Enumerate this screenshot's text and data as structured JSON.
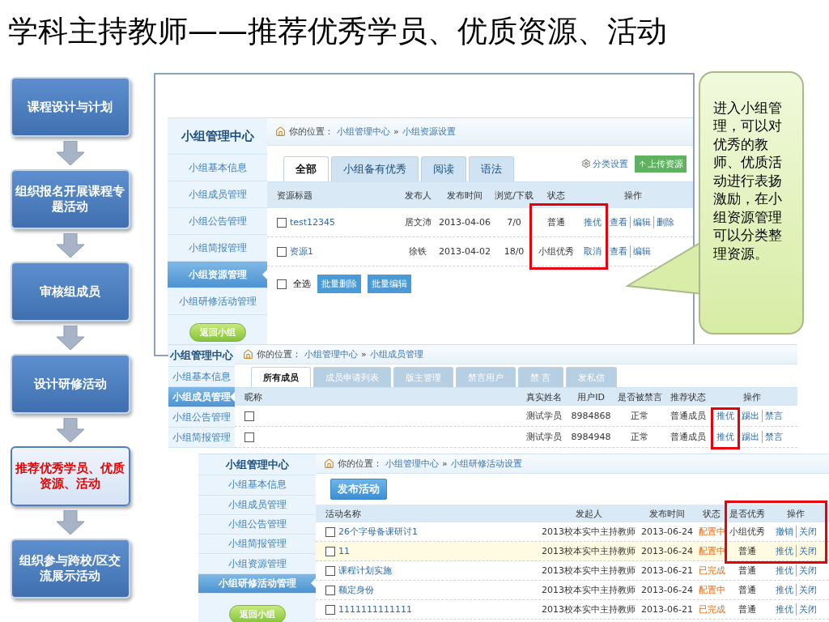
{
  "title": "学科主持教师——推荐优秀学员、优质资源、活动",
  "flow_steps": [
    {
      "label": "课程设计与计划",
      "highlighted": false
    },
    {
      "label": "组织报名开展课程专题活动",
      "highlighted": false
    },
    {
      "label": "审核组成员",
      "highlighted": false
    },
    {
      "label": "设计研修活动",
      "highlighted": false
    },
    {
      "label": "推荐优秀学员、优质资源、活动",
      "highlighted": true
    },
    {
      "label": "组织参与跨校/区交流展示活动",
      "highlighted": false
    }
  ],
  "resource_panel": {
    "sidebar": {
      "title": "小组管理中心",
      "items": [
        {
          "label": "小组基本信息",
          "selected": false
        },
        {
          "label": "小组成员管理",
          "selected": false
        },
        {
          "label": "小组公告管理",
          "selected": false
        },
        {
          "label": "小组简报管理",
          "selected": false
        },
        {
          "label": "小组资源管理",
          "selected": true
        },
        {
          "label": "小组研修活动管理",
          "selected": false
        }
      ],
      "back_button": "返回小组"
    },
    "breadcrumb": {
      "prefix": "你的位置：",
      "path": [
        "小组管理中心",
        "小组资源设置"
      ],
      "separator": "»"
    },
    "tabs": [
      {
        "label": "全部",
        "selected": true
      },
      {
        "label": "小组备有优秀",
        "selected": false
      },
      {
        "label": "阅读",
        "selected": false
      },
      {
        "label": "语法",
        "selected": false
      }
    ],
    "tools": [
      {
        "kind": "link",
        "label": "分类设置"
      },
      {
        "kind": "button",
        "label": "上传资源"
      }
    ],
    "columns": [
      {
        "label": "资源标题",
        "kind": "title"
      },
      {
        "label": "发布人",
        "kind": "text"
      },
      {
        "label": "发布时间",
        "kind": "text"
      },
      {
        "label": "浏览/下载",
        "kind": "text"
      },
      {
        "label": "状态",
        "kind": "text"
      },
      {
        "label": "操作",
        "kind": "actions"
      }
    ],
    "rows": [
      {
        "checked": false,
        "hovered": false,
        "cells": [
          "test12345",
          "居文沛",
          "2013-04-06",
          "7/0",
          "普通"
        ],
        "actions": [
          [
            "推优"
          ],
          [
            "查看",
            "编辑",
            "删除"
          ]
        ]
      },
      {
        "checked": false,
        "hovered": false,
        "cells": [
          "资源1",
          "徐铁",
          "2013-04-02",
          "18/0",
          "小组优秀"
        ],
        "actions": [
          [
            "取消"
          ],
          [
            "查看",
            "编辑"
          ]
        ]
      }
    ],
    "footer": {
      "select_all": {
        "label": "全选",
        "checked": false
      },
      "buttons": [
        "批量删除",
        "批量编辑"
      ]
    }
  },
  "member_panel": {
    "sidebar": {
      "title": "小组管理中心",
      "items": [
        {
          "label": "小组基本信息",
          "selected": false
        },
        {
          "label": "小组成员管理",
          "selected": true
        },
        {
          "label": "小组公告管理",
          "selected": false
        },
        {
          "label": "小组简报管理",
          "selected": false
        }
      ]
    },
    "breadcrumb": {
      "prefix": "你的位置：",
      "path": [
        "小组管理中心",
        "小组成员管理"
      ],
      "separator": "»"
    },
    "tabs": [
      {
        "label": "所有成员",
        "selected": true
      },
      {
        "label": "成员申请列表",
        "selected": false
      },
      {
        "label": "版主管理",
        "selected": false
      },
      {
        "label": "禁言用户",
        "selected": false
      },
      {
        "label": "禁 言",
        "selected": false
      },
      {
        "label": "发私信",
        "selected": false
      }
    ],
    "columns": [
      {
        "label": "昵称",
        "kind": "title"
      },
      {
        "label": "真实姓名",
        "kind": "text"
      },
      {
        "label": "用户ID",
        "kind": "text"
      },
      {
        "label": "是否被禁言",
        "kind": "text"
      },
      {
        "label": "推荐状态",
        "kind": "text"
      },
      {
        "label": "操作",
        "kind": "actions"
      }
    ],
    "rows": [
      {
        "checked": false,
        "hovered": false,
        "cells": [
          "",
          "测试学员",
          "8984868",
          "正常",
          "普通成员"
        ],
        "actions": [
          [
            "推优"
          ],
          [
            "踢出",
            "禁言"
          ]
        ]
      },
      {
        "checked": false,
        "hovered": false,
        "cells": [
          "",
          "测试学员",
          "8984948",
          "正常",
          "普通成员"
        ],
        "actions": [
          [
            "推优"
          ],
          [
            "踢出",
            "禁言"
          ]
        ]
      }
    ]
  },
  "activity_panel": {
    "sidebar": {
      "title": "小组管理中心",
      "items": [
        {
          "label": "小组基本信息",
          "selected": false
        },
        {
          "label": "小组成员管理",
          "selected": false
        },
        {
          "label": "小组公告管理",
          "selected": false
        },
        {
          "label": "小组简报管理",
          "selected": false
        },
        {
          "label": "小组资源管理",
          "selected": false
        },
        {
          "label": "小组研修活动管理",
          "selected": true
        }
      ],
      "back_button": "返回小组"
    },
    "breadcrumb": {
      "prefix": "你的位置：",
      "path": [
        "小组管理中心",
        "小组研修活动设置"
      ],
      "separator": "»"
    },
    "publish_button": "发布活动",
    "columns": [
      {
        "label": "活动名称",
        "kind": "title"
      },
      {
        "label": "发起人",
        "kind": "text"
      },
      {
        "label": "发布时间",
        "kind": "text"
      },
      {
        "label": "状态",
        "kind": "status"
      },
      {
        "label": "是否优秀",
        "kind": "text"
      },
      {
        "label": "操作",
        "kind": "actions"
      }
    ],
    "rows": [
      {
        "checked": false,
        "hovered": false,
        "cells": [
          "26个字母备课研讨1",
          "2013校本实中主持教师",
          "2013-06-24",
          "配置中",
          "小组优秀"
        ],
        "actions": [
          [
            "撤销",
            "关闭"
          ]
        ]
      },
      {
        "checked": false,
        "hovered": true,
        "cells": [
          "11",
          "2013校本实中主持教师",
          "2013-06-24",
          "配置中",
          "普通"
        ],
        "actions": [
          [
            "推优",
            "关闭"
          ]
        ]
      },
      {
        "checked": false,
        "hovered": false,
        "cells": [
          "课程计划实施",
          "2013校本实中主持教师",
          "2013-06-21",
          "已完成",
          "普通"
        ],
        "actions": [
          [
            "推优",
            "关闭"
          ]
        ]
      },
      {
        "checked": false,
        "hovered": false,
        "cells": [
          "额定身份",
          "2013校本实中主持教师",
          "2013-06-24",
          "配置中",
          "普通"
        ],
        "actions": [
          [
            "推优",
            "关闭"
          ]
        ]
      },
      {
        "checked": false,
        "hovered": false,
        "cells": [
          "1111111111111",
          "2013校本实中主持教师",
          "2013-06-21",
          "已完成",
          "普通"
        ],
        "actions": [
          [
            "推优",
            "关闭"
          ]
        ]
      }
    ]
  },
  "callout": "进入小组管理，可以对优秀的教师、优质活动进行表扬激励，在小组资源管理可以分类整理资源。"
}
